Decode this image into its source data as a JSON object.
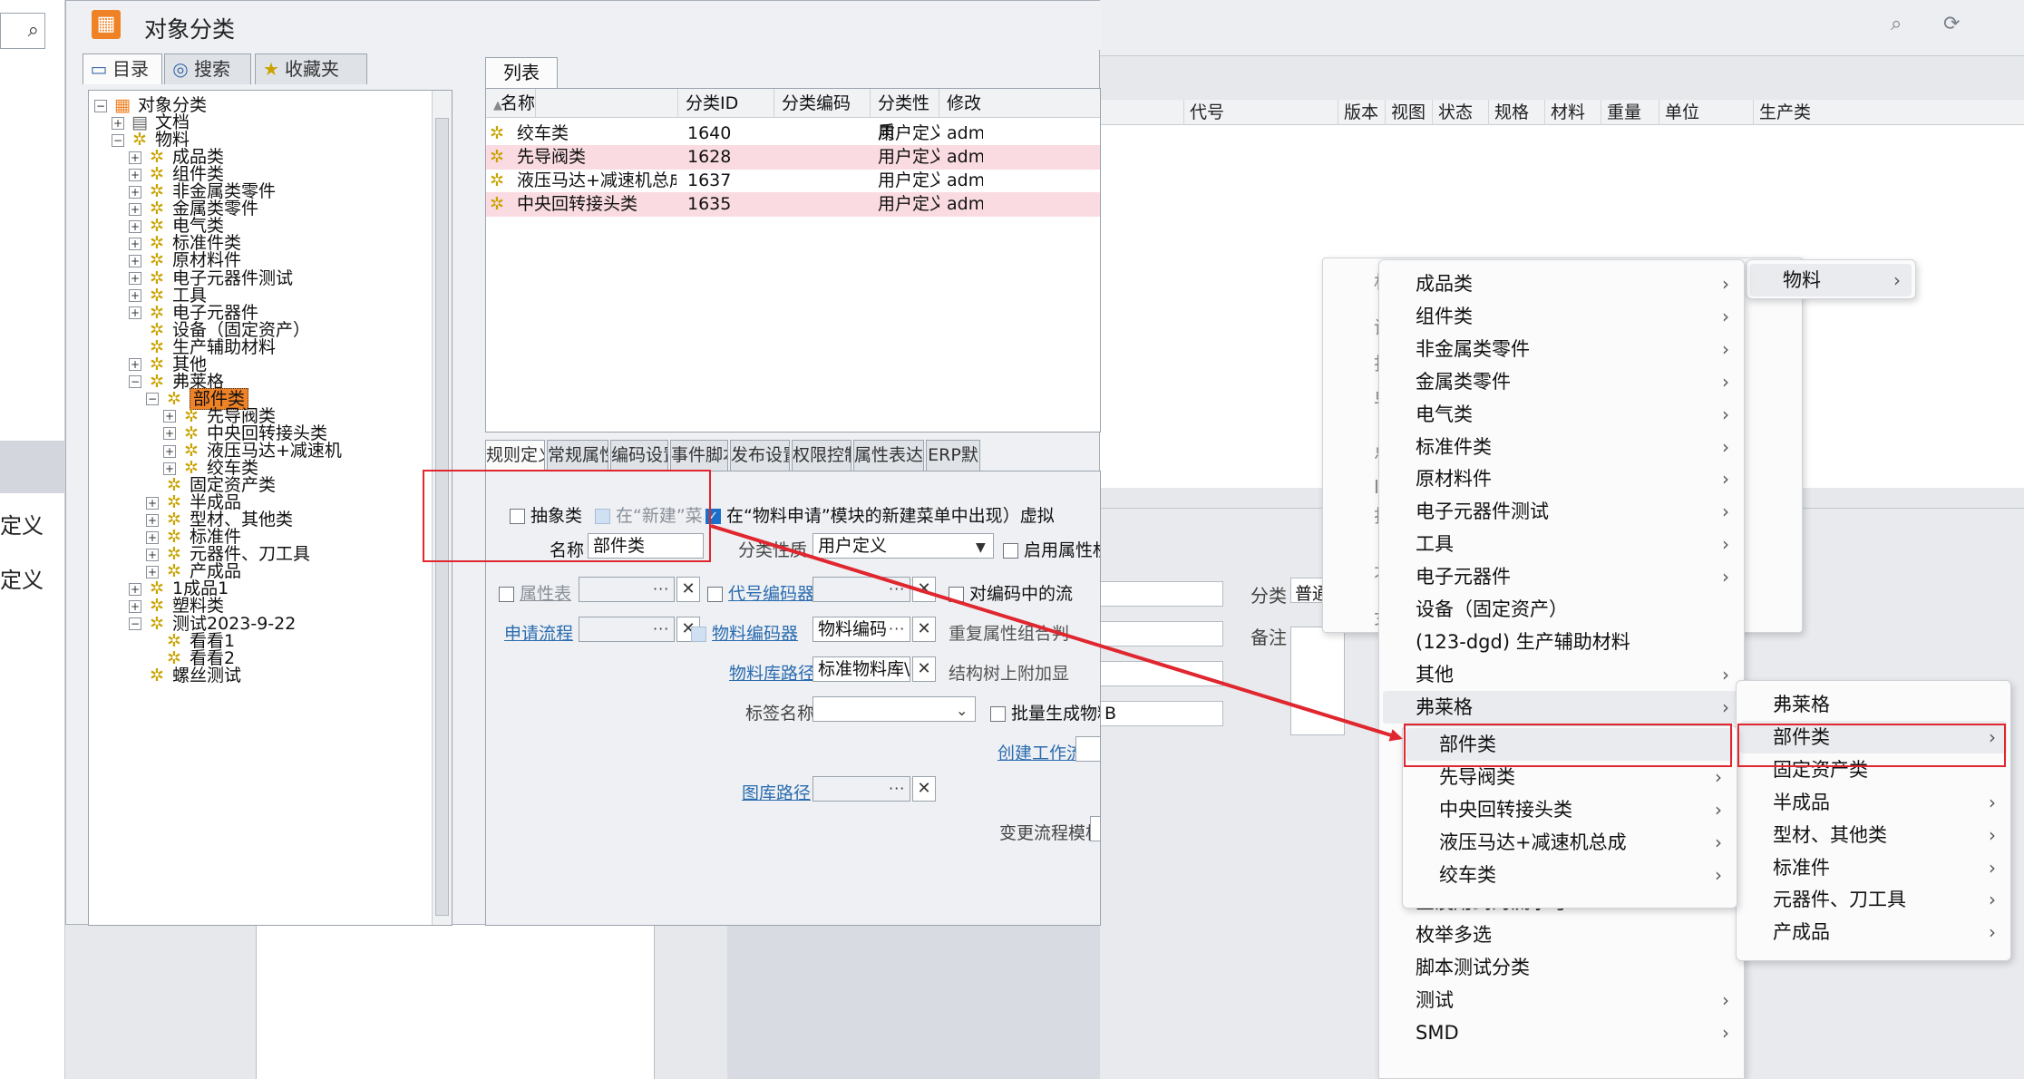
{
  "window": {
    "title": "对象分类",
    "logo_icon": "app-logo-icon"
  },
  "left_tabs": [
    {
      "label": "目录",
      "icon": "computer-icon"
    },
    {
      "label": "搜索",
      "icon": "globe-search-icon"
    },
    {
      "label": "收藏夹",
      "icon": "folder-star-icon"
    }
  ],
  "tree": [
    {
      "label": "对象分类",
      "level": 0,
      "exp": "-",
      "icon": "root"
    },
    {
      "label": "文档",
      "level": 1,
      "exp": "+",
      "icon": "doc"
    },
    {
      "label": "物料",
      "level": 1,
      "exp": "-",
      "icon": "gear"
    },
    {
      "label": "成品类",
      "level": 2,
      "exp": "+",
      "icon": "gear"
    },
    {
      "label": "组件类",
      "level": 2,
      "exp": "+",
      "icon": "gear"
    },
    {
      "label": "非金属类零件",
      "level": 2,
      "exp": "+",
      "icon": "gear"
    },
    {
      "label": "金属类零件",
      "level": 2,
      "exp": "+",
      "icon": "gear"
    },
    {
      "label": "电气类",
      "level": 2,
      "exp": "+",
      "icon": "gear"
    },
    {
      "label": "标准件类",
      "level": 2,
      "exp": "+",
      "icon": "gear"
    },
    {
      "label": "原材料件",
      "level": 2,
      "exp": "+",
      "icon": "gear"
    },
    {
      "label": "电子元器件测试",
      "level": 2,
      "exp": "+",
      "icon": "gear"
    },
    {
      "label": "工具",
      "level": 2,
      "exp": "+",
      "icon": "gear"
    },
    {
      "label": "电子元器件",
      "level": 2,
      "exp": "+",
      "icon": "gear"
    },
    {
      "label": "设备（固定资产）",
      "level": 2,
      "exp": "",
      "icon": "gear"
    },
    {
      "label": "生产辅助材料",
      "level": 2,
      "exp": "",
      "icon": "gear"
    },
    {
      "label": "其他",
      "level": 2,
      "exp": "+",
      "icon": "gear"
    },
    {
      "label": "弗莱格",
      "level": 2,
      "exp": "-",
      "icon": "gear"
    },
    {
      "label": "部件类",
      "level": 3,
      "exp": "-",
      "icon": "gear",
      "selected": true
    },
    {
      "label": "先导阀类",
      "level": 4,
      "exp": "+",
      "icon": "gear"
    },
    {
      "label": "中央回转接头类",
      "level": 4,
      "exp": "+",
      "icon": "gear"
    },
    {
      "label": "液压马达+减速机",
      "level": 4,
      "exp": "+",
      "icon": "gear"
    },
    {
      "label": "绞车类",
      "level": 4,
      "exp": "+",
      "icon": "gear"
    },
    {
      "label": "固定资产类",
      "level": 3,
      "exp": "",
      "icon": "gear"
    },
    {
      "label": "半成品",
      "level": 3,
      "exp": "+",
      "icon": "gear"
    },
    {
      "label": "型材、其他类",
      "level": 3,
      "exp": "+",
      "icon": "gear"
    },
    {
      "label": "标准件",
      "level": 3,
      "exp": "+",
      "icon": "gear"
    },
    {
      "label": "元器件、刀工具",
      "level": 3,
      "exp": "+",
      "icon": "gear"
    },
    {
      "label": "产成品",
      "level": 3,
      "exp": "+",
      "icon": "gear"
    },
    {
      "label": "1成品1",
      "level": 2,
      "exp": "+",
      "icon": "gear"
    },
    {
      "label": "塑料类",
      "level": 2,
      "exp": "+",
      "icon": "gear"
    },
    {
      "label": "测试2023-9-22",
      "level": 2,
      "exp": "-",
      "icon": "gear"
    },
    {
      "label": "看看1",
      "level": 3,
      "exp": "",
      "icon": "gear"
    },
    {
      "label": "看看2",
      "level": 3,
      "exp": "",
      "icon": "gear"
    },
    {
      "label": "螺丝测试",
      "level": 2,
      "exp": "",
      "icon": "gear"
    }
  ],
  "list": {
    "tab": "列表",
    "columns": [
      "名称",
      "分类ID",
      "分类编码",
      "分类性质",
      "修改"
    ],
    "rows": [
      {
        "name": "绞车类",
        "id": "1640",
        "code": "",
        "nature": "用户定义",
        "mod": "adm",
        "pink": false
      },
      {
        "name": "先导阀类",
        "id": "1628",
        "code": "",
        "nature": "用户定义",
        "mod": "adm",
        "pink": true
      },
      {
        "name": "液压马达+减速机总成",
        "id": "1637",
        "code": "",
        "nature": "用户定义",
        "mod": "adm",
        "pink": false
      },
      {
        "name": "中央回转接头类",
        "id": "1635",
        "code": "",
        "nature": "用户定义",
        "mod": "adm",
        "pink": true
      }
    ]
  },
  "bottom_tabs": [
    "规则定义",
    "常规属性",
    "编码设置",
    "事件脚本",
    "发布设置",
    "权限控制",
    "属性表达式",
    "ERP默"
  ],
  "form": {
    "abstract_label": "抽象类",
    "new_menu_label": "在“新建”菜单中显示",
    "apply_menu_label": "在“物料申请”模块的新建菜单中出现",
    "virtual_label": "虚拟",
    "name_label": "名称",
    "name_value": "部件类",
    "nature_label": "分类性质",
    "nature_value": "用户定义",
    "attr_perm_label": "启用属性权限",
    "attr_table_label": "属性表",
    "code_encoder_label": "代号编码器",
    "code_flow_label": "对编码中的流",
    "apply_flow_label": "申请流程",
    "mat_encoder_label": "物料编码器",
    "mat_encoder_value": "物料编码",
    "repeat_attr_label": "重复属性组合判",
    "mat_lib_label": "物料库路径",
    "mat_lib_value": "标准物料库\\物",
    "struct_tree_label": "结构树上附加显",
    "tag_label": "标签名称",
    "batch_label": "批量生成物料",
    "workflow_label": "创建工作流",
    "drawing_label": "图库路径",
    "change_flow_label": "变更流程模板"
  },
  "bg": {
    "left_labels": [
      "定义",
      "定义"
    ],
    "right_headers": [
      "代号",
      "版本",
      "视图",
      "状态",
      "规格",
      "材料",
      "重量",
      "单位",
      "生产类型"
    ],
    "category_label": "分类",
    "category_value": "普通",
    "remark_label": "备注",
    "unit_suffix": "B"
  },
  "menu_stub": {
    "items": [
      "材",
      "设",
      "打",
      "早",
      "点",
      "I",
      "打",
      "才",
      "女"
    ]
  },
  "menu_root": {
    "item": "物料"
  },
  "menu_main": {
    "items": [
      {
        "label": "成品类",
        "arrow": true
      },
      {
        "label": "组件类",
        "arrow": true
      },
      {
        "label": "非金属类零件",
        "arrow": true
      },
      {
        "label": "金属类零件",
        "arrow": true
      },
      {
        "label": "电气类",
        "arrow": true
      },
      {
        "label": "标准件类",
        "arrow": true
      },
      {
        "label": "原材料件",
        "arrow": true
      },
      {
        "label": "电子元器件测试",
        "arrow": true
      },
      {
        "label": "工具",
        "arrow": true
      },
      {
        "label": "电子元器件",
        "arrow": true
      },
      {
        "label": "设备（固定资产）",
        "arrow": false
      },
      {
        "label": "(123-dgd) 生产辅助材料",
        "arrow": false
      },
      {
        "label": "其他",
        "arrow": true
      },
      {
        "label": "弗莱格",
        "arrow": true
      },
      {
        "label": "",
        "arrow": false
      },
      {
        "label": "",
        "arrow": false
      },
      {
        "label": "",
        "arrow": false
      },
      {
        "label": "",
        "arrow": false
      },
      {
        "label": "",
        "arrow": false
      },
      {
        "label": "查没用到的流水号",
        "arrow": false
      },
      {
        "label": "枚举多选",
        "arrow": false
      },
      {
        "label": "脚本测试分类",
        "arrow": false
      },
      {
        "label": "测试",
        "arrow": true
      },
      {
        "label": "SMD",
        "arrow": true
      }
    ]
  },
  "menu_fl": {
    "items": [
      {
        "label": "弗莱格",
        "arrow": false
      },
      {
        "label": "部件类",
        "arrow": true
      },
      {
        "label": "固定资产类",
        "arrow": false
      },
      {
        "label": "半成品",
        "arrow": true
      },
      {
        "label": "型材、其他类",
        "arrow": true
      },
      {
        "label": "标准件",
        "arrow": true
      },
      {
        "label": "元器件、刀工具",
        "arrow": true
      },
      {
        "label": "产成品",
        "arrow": true
      }
    ]
  },
  "menu_parts": {
    "items": [
      {
        "label": "部件类",
        "arrow": false
      },
      {
        "label": "先导阀类",
        "arrow": true
      },
      {
        "label": "中央回转接头类",
        "arrow": true
      },
      {
        "label": "液压马达+减速机总成",
        "arrow": true
      },
      {
        "label": "绞车类",
        "arrow": true
      }
    ]
  },
  "colors": {
    "accent": "#f08226",
    "annotation": "#e0262f",
    "row_highlight": "#f9dbe1",
    "checkbox_blue": "#1b6fc9"
  }
}
